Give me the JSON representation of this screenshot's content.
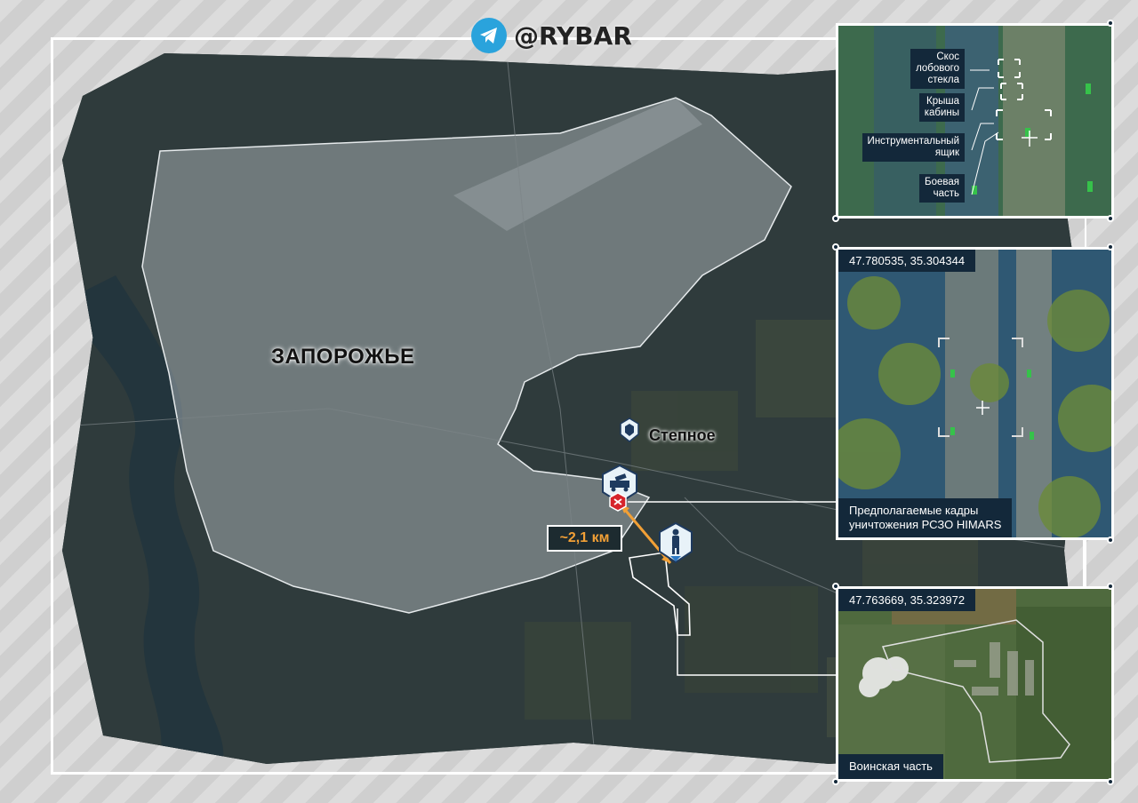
{
  "header": {
    "handle": "@RYBAR",
    "icon": "telegram-icon"
  },
  "map": {
    "city_label": "ЗАПОРОЖЬЕ",
    "town_label": "Степное",
    "distance_label": "~2,1 км",
    "markers": {
      "town": "settlement-icon",
      "himars": "mlrs-vehicle-icon",
      "destroyed": "destroyed-icon",
      "military_unit": "soldier-icon"
    },
    "colors": {
      "distance_arrow": "#f2a036",
      "destroyed_marker": "#d6242b",
      "marker_fill": "#e8f2f8"
    }
  },
  "panels": {
    "top": {
      "callouts": [
        "Скос\nлобового\nстекла",
        "Крыша\nкабины",
        "Инструментальный\nящик",
        "Боевая\nчасть"
      ]
    },
    "middle": {
      "coordinates": "47.780535, 35.304344",
      "caption": "Предполагаемые кадры\nуничтожения РСЗО HIMARS"
    },
    "bottom": {
      "coordinates": "47.763669, 35.323972",
      "caption": "Воинская часть"
    }
  }
}
